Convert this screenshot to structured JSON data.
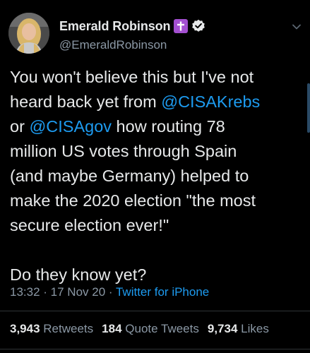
{
  "author": {
    "display_name": "Emerald Robinson",
    "handle": "@EmeraldRobinson"
  },
  "badges": {
    "cross": "purple-cross-icon",
    "verified": "verified-check-icon"
  },
  "tweet": {
    "line1": "You won't believe this but I've not",
    "line2_prefix": "heard back yet from ",
    "mention1": "@CISAKrebs",
    "line3_prefix": "or ",
    "mention2": "@CISAgov",
    "line3_suffix": " how routing 78",
    "line4": "million US votes through Spain",
    "line5": "(and maybe Germany) helped to",
    "line6": "make the 2020 election \"the most",
    "line7": "secure election ever!\"",
    "line9": "Do they know yet?"
  },
  "meta": {
    "time": "13:32",
    "separator1": " · ",
    "date": "17 Nov 20",
    "separator2": " · ",
    "source": "Twitter for iPhone"
  },
  "stats": {
    "retweets_count": "3,943",
    "retweets_label": "Retweets",
    "quotes_count": "184",
    "quotes_label": "Quote Tweets",
    "likes_count": "9,734",
    "likes_label": "Likes"
  },
  "colors": {
    "background": "#000000",
    "text": "#e7e9ea",
    "secondary": "#8b98a5",
    "link": "#1d9bf0",
    "cross_badge": "#a34fd0",
    "divider": "#2f3336"
  }
}
